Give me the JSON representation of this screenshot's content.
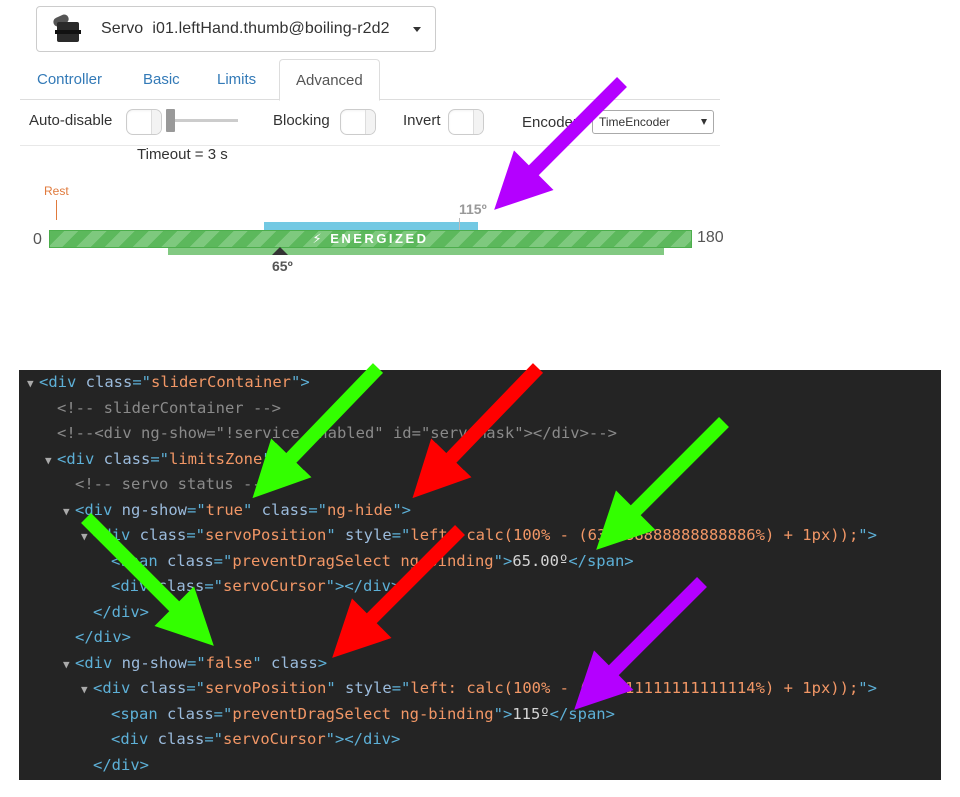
{
  "servo_selector": {
    "type_label": "Servo",
    "name": "i01.leftHand.thumb@boiling-r2d2",
    "icon": "servo-icon"
  },
  "tabs": [
    {
      "label": "Controller",
      "active": false
    },
    {
      "label": "Basic",
      "active": false
    },
    {
      "label": "Limits",
      "active": false
    },
    {
      "label": "Advanced",
      "active": true
    }
  ],
  "settings": {
    "auto_disable_label": "Auto-disable",
    "blocking_label": "Blocking",
    "invert_label": "Invert",
    "encoder_label": "Encoder",
    "encoder_value": "TimeEncoder",
    "timeout_text": "Timeout = 3 s"
  },
  "slider": {
    "rest_label": "Rest",
    "min_label": "0",
    "max_label": "180",
    "status_text": "ENERGIZED",
    "target_label": "115º",
    "current_label": "65º",
    "track_color": "#5cb85c",
    "limit_color": "#5bc0de"
  },
  "code_lines": [
    {
      "indent": 0,
      "tri": "▼",
      "parts": [
        [
          "tag",
          "<div "
        ],
        [
          "attr",
          "class"
        ],
        [
          "tag",
          "=\""
        ],
        [
          "val",
          "sliderContainer"
        ],
        [
          "tag",
          "\">"
        ]
      ]
    },
    {
      "indent": 1,
      "tri": "",
      "parts": [
        [
          "cmt",
          "<!-- sliderContainer -->"
        ]
      ]
    },
    {
      "indent": 1,
      "tri": "",
      "parts": [
        [
          "cmt",
          "<!--<div ng-show=\"!service.enabled\" id=\"servoMask\"></div>-->"
        ]
      ]
    },
    {
      "indent": 1,
      "tri": "▼",
      "parts": [
        [
          "tag",
          "<div "
        ],
        [
          "attr",
          "class"
        ],
        [
          "tag",
          "=\""
        ],
        [
          "val",
          "limitsZone"
        ],
        [
          "tag",
          "\">"
        ]
      ]
    },
    {
      "indent": 2,
      "tri": "",
      "parts": [
        [
          "cmt",
          "<!-- servo status -->"
        ]
      ]
    },
    {
      "indent": 2,
      "tri": "▼",
      "parts": [
        [
          "tag",
          "<div "
        ],
        [
          "attr",
          "ng-show"
        ],
        [
          "tag",
          "=\""
        ],
        [
          "val",
          "true"
        ],
        [
          "tag",
          "\" "
        ],
        [
          "attr",
          "class"
        ],
        [
          "tag",
          "=\""
        ],
        [
          "val",
          "ng-hide"
        ],
        [
          "tag",
          "\">"
        ]
      ]
    },
    {
      "indent": 3,
      "tri": "▼",
      "parts": [
        [
          "tag",
          "<div "
        ],
        [
          "attr",
          "class"
        ],
        [
          "tag",
          "=\""
        ],
        [
          "val",
          "servoPosition"
        ],
        [
          "tag",
          "\" "
        ],
        [
          "attr",
          "style"
        ],
        [
          "tag",
          "=\""
        ],
        [
          "val",
          "left: calc(100% - (63.888888888888886%) + 1px));"
        ],
        [
          "tag",
          "\">"
        ]
      ]
    },
    {
      "indent": 4,
      "tri": "",
      "parts": [
        [
          "tag",
          "<span "
        ],
        [
          "attr",
          "class"
        ],
        [
          "tag",
          "=\""
        ],
        [
          "val",
          "preventDragSelect ng-binding"
        ],
        [
          "tag",
          "\">"
        ],
        [
          "txt",
          "65.00º"
        ],
        [
          "tag",
          "</span>"
        ]
      ]
    },
    {
      "indent": 4,
      "tri": "",
      "parts": [
        [
          "tag",
          "<div "
        ],
        [
          "attr",
          "class"
        ],
        [
          "tag",
          "=\""
        ],
        [
          "val",
          "servoCursor"
        ],
        [
          "tag",
          "\"></div>"
        ]
      ]
    },
    {
      "indent": 3,
      "tri": "",
      "parts": [
        [
          "tag",
          "</div>"
        ]
      ]
    },
    {
      "indent": 2,
      "tri": "",
      "parts": [
        [
          "tag",
          "</div>"
        ]
      ]
    },
    {
      "indent": 2,
      "tri": "▼",
      "parts": [
        [
          "tag",
          "<div "
        ],
        [
          "attr",
          "ng-show"
        ],
        [
          "tag",
          "=\""
        ],
        [
          "val",
          "false"
        ],
        [
          "tag",
          "\" "
        ],
        [
          "attr",
          "class"
        ],
        [
          "tag",
          ">"
        ]
      ]
    },
    {
      "indent": 3,
      "tri": "▼",
      "parts": [
        [
          "tag",
          "<div "
        ],
        [
          "attr",
          "class"
        ],
        [
          "tag",
          "=\""
        ],
        [
          "val",
          "servoPosition"
        ],
        [
          "tag",
          "\" "
        ],
        [
          "attr",
          "style"
        ],
        [
          "tag",
          "=\""
        ],
        [
          "val",
          "left: calc(100% - (36.111111111111114%) + 1px));"
        ],
        [
          "tag",
          "\">"
        ]
      ]
    },
    {
      "indent": 4,
      "tri": "",
      "parts": [
        [
          "tag",
          "<span "
        ],
        [
          "attr",
          "class"
        ],
        [
          "tag",
          "=\""
        ],
        [
          "val",
          "preventDragSelect ng-binding"
        ],
        [
          "tag",
          "\">"
        ],
        [
          "txt",
          "115º"
        ],
        [
          "tag",
          "</span>"
        ]
      ]
    },
    {
      "indent": 4,
      "tri": "",
      "parts": [
        [
          "tag",
          "<div "
        ],
        [
          "attr",
          "class"
        ],
        [
          "tag",
          "=\""
        ],
        [
          "val",
          "servoCursor"
        ],
        [
          "tag",
          "\"></div>"
        ]
      ]
    },
    {
      "indent": 3,
      "tri": "",
      "parts": [
        [
          "tag",
          "</div>"
        ]
      ]
    }
  ],
  "annotation_colors": {
    "purple": "#b400ff",
    "green": "#33ff00",
    "red": "#ff0000"
  }
}
